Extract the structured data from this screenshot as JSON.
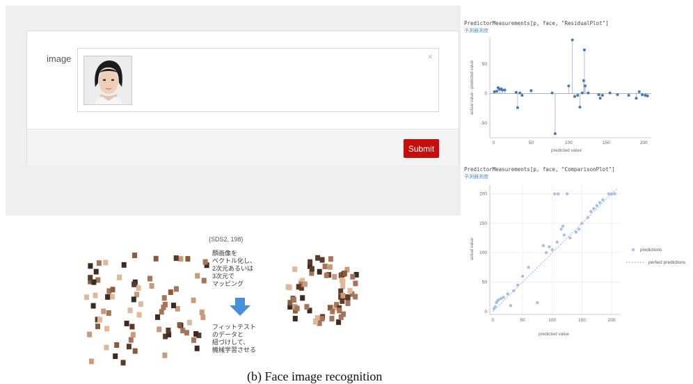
{
  "form": {
    "label": "image",
    "close_symbol": "×",
    "submit_label": "Submit"
  },
  "residual_plot": {
    "code": "PredictorMeasurements[p, face, \"ResidualPlot\"]",
    "link": "予測器測度",
    "ylabel": "actual value - predicted value",
    "xlabel": "predicted value",
    "xticks": [
      "0",
      "50",
      "100",
      "150",
      "200"
    ],
    "yticks": [
      "50",
      "0",
      "-50"
    ]
  },
  "comparison_plot": {
    "code": "PredictorMeasurements[p, face, \"ComparisonPlot\"]",
    "link": "予測器測度",
    "ylabel": "actual value",
    "xlabel": "predicted value",
    "xticks": [
      "0",
      "50",
      "100",
      "150",
      "200"
    ],
    "yticks": [
      "200",
      "150",
      "100",
      "50",
      "0"
    ],
    "legend_predictions": "predictions",
    "legend_perfect": "perfect predictions"
  },
  "figure": {
    "header": "{SDS2, 198}",
    "text_top": "顔画像を\nベクトル化し、\n2次元あるいは\n3次元で\nマッピング",
    "text_bottom": "フィットテスト\nのデータと\n紐づけして、\n機械学習させる",
    "caption": "(b) Face image recognition"
  },
  "colors": {
    "accent": "#c40d0d",
    "plot_point": "#4a77b8",
    "arrow": "#4a8fd9"
  },
  "chart_data": [
    {
      "type": "scatter",
      "title": "",
      "xlabel": "predicted value",
      "ylabel": "actual value - predicted value",
      "xlim": [
        -5,
        210
      ],
      "ylim": [
        -75,
        95
      ],
      "points": [
        [
          1,
          3
        ],
        [
          4,
          4
        ],
        [
          6,
          10
        ],
        [
          8,
          7
        ],
        [
          10,
          8
        ],
        [
          12,
          6
        ],
        [
          15,
          6
        ],
        [
          30,
          2
        ],
        [
          32,
          -24
        ],
        [
          35,
          1
        ],
        [
          38,
          -3
        ],
        [
          50,
          5
        ],
        [
          78,
          1
        ],
        [
          82,
          -68
        ],
        [
          100,
          13
        ],
        [
          105,
          91
        ],
        [
          108,
          -5
        ],
        [
          112,
          -3
        ],
        [
          115,
          -23
        ],
        [
          118,
          1
        ],
        [
          120,
          22
        ],
        [
          121,
          74
        ],
        [
          122,
          13
        ],
        [
          126,
          1
        ],
        [
          140,
          -2
        ],
        [
          142,
          -8
        ],
        [
          145,
          -3
        ],
        [
          155,
          1
        ],
        [
          165,
          -2
        ],
        [
          180,
          -3
        ],
        [
          190,
          -8
        ],
        [
          194,
          3
        ],
        [
          198,
          -2
        ],
        [
          202,
          -3
        ],
        [
          205,
          -4
        ]
      ]
    },
    {
      "type": "scatter",
      "title": "",
      "xlabel": "predicted value",
      "ylabel": "actual value",
      "xlim": [
        -5,
        215
      ],
      "ylim": [
        -5,
        215
      ],
      "series": [
        {
          "name": "predictions",
          "points": [
            [
              2,
              5
            ],
            [
              4,
              8
            ],
            [
              6,
              15
            ],
            [
              8,
              18
            ],
            [
              10,
              20
            ],
            [
              14,
              22
            ],
            [
              18,
              24
            ],
            [
              25,
              30
            ],
            [
              30,
              10
            ],
            [
              35,
              35
            ],
            [
              42,
              45
            ],
            [
              50,
              60
            ],
            [
              60,
              75
            ],
            [
              75,
              15
            ],
            [
              85,
              112
            ],
            [
              90,
              100
            ],
            [
              95,
              110
            ],
            [
              100,
              105
            ],
            [
              104,
              200
            ],
            [
              108,
              118
            ],
            [
              110,
              200
            ],
            [
              115,
              140
            ],
            [
              118,
              145
            ],
            [
              120,
              130
            ],
            [
              125,
              200
            ],
            [
              130,
              125
            ],
            [
              140,
              135
            ],
            [
              145,
              140
            ],
            [
              150,
              150
            ],
            [
              160,
              160
            ],
            [
              165,
              170
            ],
            [
              170,
              175
            ],
            [
              175,
              180
            ],
            [
              180,
              185
            ],
            [
              185,
              190
            ],
            [
              195,
              200
            ],
            [
              200,
              200
            ],
            [
              205,
              200
            ]
          ]
        },
        {
          "name": "perfect predictions",
          "line": [
            [
              0,
              0
            ],
            [
              210,
              210
            ]
          ]
        }
      ]
    }
  ]
}
